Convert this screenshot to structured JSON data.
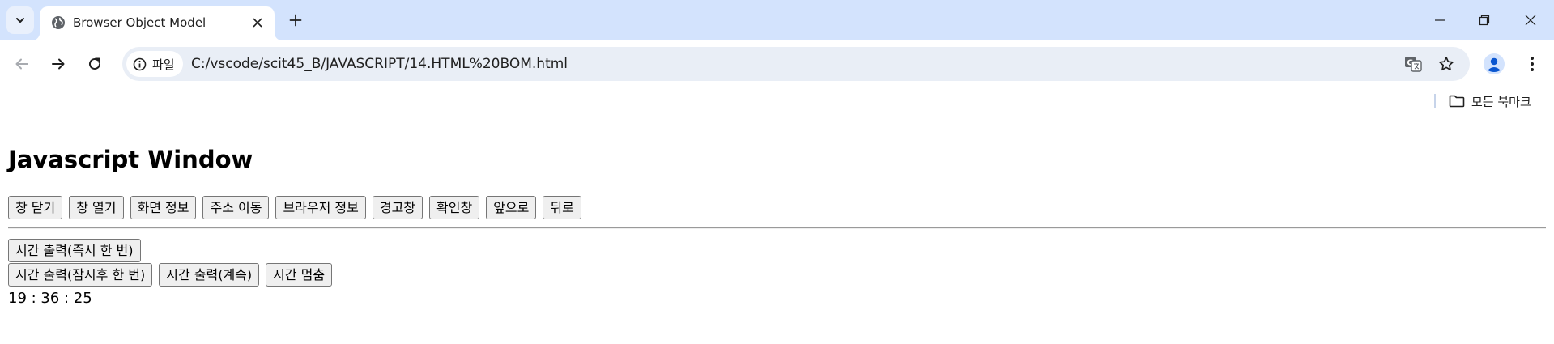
{
  "browser": {
    "tab": {
      "title": "Browser Object Model"
    },
    "omnibox": {
      "chip_label": "파일",
      "url": "C:/vscode/scit45_B/JAVASCRIPT/14.HTML%20BOM.html"
    },
    "bookmarks": {
      "all_bookmarks_label": "모든 북마크"
    },
    "colors": {
      "tabstrip": "#d3e3fd",
      "omnibox": "#e9eef6",
      "profile": "#0b57d0"
    }
  },
  "page": {
    "title": "Javascript Window",
    "row1_buttons": [
      {
        "label": "창 닫기"
      },
      {
        "label": "창 열기"
      },
      {
        "label": "화면 정보"
      },
      {
        "label": "주소 이동"
      },
      {
        "label": "브라우저 정보"
      },
      {
        "label": "경고창"
      },
      {
        "label": "확인창"
      },
      {
        "label": "앞으로"
      },
      {
        "label": "뒤로"
      }
    ],
    "time_once_button": "시간 출력(즉시 한 번)",
    "row3_buttons": [
      {
        "label": "시간 출력(잠시후 한 번)"
      },
      {
        "label": "시간 출력(계속)"
      },
      {
        "label": "시간 멈춤"
      }
    ],
    "clock": "19 : 36 : 25"
  }
}
